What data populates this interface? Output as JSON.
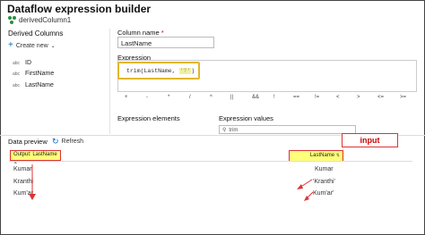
{
  "window": {
    "title": "Dataflow expression builder",
    "subtitle": "derivedColumn1"
  },
  "left_panel": {
    "title": "Derived Columns",
    "create_new_label": "Create new",
    "columns": [
      {
        "type_badge": "abc",
        "name": "ID"
      },
      {
        "type_badge": "abc",
        "name": "FirstName"
      },
      {
        "type_badge": "abc",
        "name": "LastName"
      }
    ]
  },
  "column_name": {
    "label": "Column name",
    "required_mark": "*",
    "value": "LastName"
  },
  "expression": {
    "label": "Expression",
    "code_prefix": "trim(LastName, ",
    "code_selected": "'?'",
    "code_suffix": ")"
  },
  "operators": [
    "+",
    "-",
    "*",
    "/",
    "^",
    "||",
    "&&",
    "!",
    "==",
    "!=",
    "<",
    ">",
    "<=",
    ">="
  ],
  "expression_elements": {
    "label": "Expression elements"
  },
  "expression_values": {
    "label": "Expression values",
    "filter_placeholder": "trim"
  },
  "data_preview": {
    "title": "Data preview",
    "refresh_label": "Refresh",
    "callout_label": "input",
    "output_header": "Output: LastName",
    "input_header": "LastName",
    "output_values": [
      "Kumar",
      "Kranthi",
      "Kum'ar"
    ],
    "input_values": [
      "Kumar",
      "'Kranthi'",
      "Kum'ar'"
    ]
  },
  "colors": {
    "highlight": "#ffff7a",
    "annotation_red": "#d33",
    "accent_blue": "#0a66c2"
  }
}
